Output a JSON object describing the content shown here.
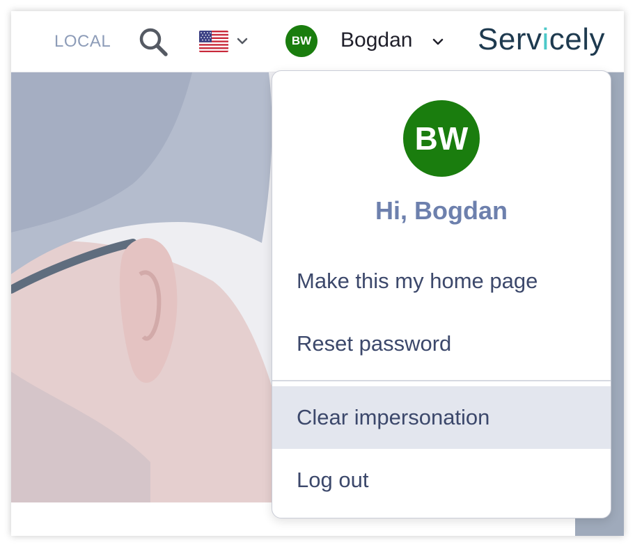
{
  "header": {
    "env_label": "LOCAL",
    "language": {
      "current": "English (US)",
      "flag_icon": "us-flag-icon"
    },
    "user": {
      "initials": "BW",
      "name": "Bogdan"
    },
    "brand": {
      "part1": "Serv",
      "accent": "i",
      "part2": "cely"
    }
  },
  "dropdown": {
    "avatar_initials": "BW",
    "greeting": "Hi, Bogdan",
    "items": [
      {
        "label": "Make this my home page"
      },
      {
        "label": "Reset password"
      },
      {
        "label": "Clear impersonation",
        "highlighted": true
      },
      {
        "label": "Log out"
      }
    ]
  },
  "colors": {
    "avatar_bg": "#1a7d0e",
    "greeting_text": "#6d80ad",
    "menu_text": "#3c486b",
    "highlight_bg": "#e3e6ee",
    "brand_text": "#1e3a4f",
    "brand_accent": "#4cc8c8",
    "env_label": "#8d9cb8"
  }
}
